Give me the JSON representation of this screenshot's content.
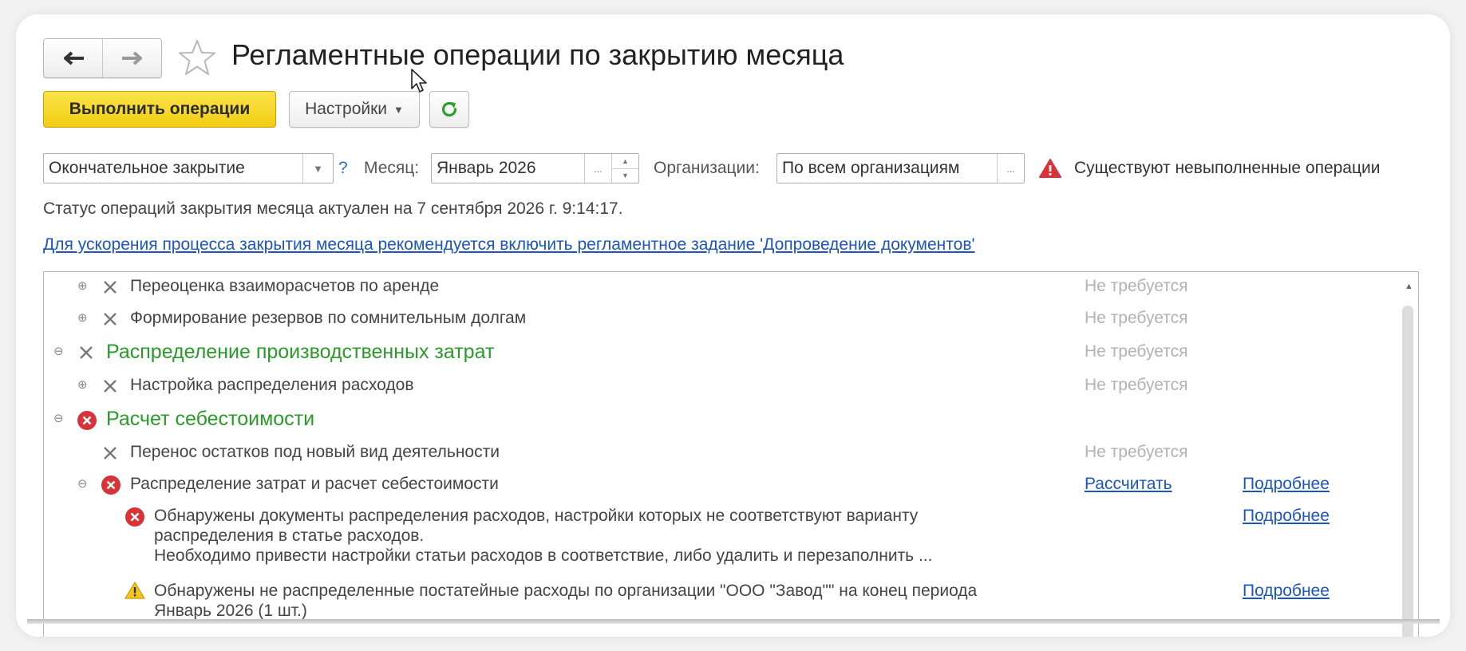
{
  "header": {
    "title": "Регламентные операции по закрытию месяца"
  },
  "toolbar": {
    "run_label": "Выполнить операции",
    "settings_label": "Настройки"
  },
  "filters": {
    "mode_value": "Окончательное закрытие",
    "help_label": "?",
    "month_label": "Месяц:",
    "month_value": "Январь 2026",
    "org_label": "Организации:",
    "org_value": "По всем организациям",
    "select_dots": "...",
    "warning_text": "Существуют невыполненные операции"
  },
  "status": {
    "text": "Статус операций закрытия месяца актуален на 7 сентября 2026 г. 9:14:17.",
    "hint_link": "Для ускорения процесса закрытия месяца рекомендуется включить регламентное задание 'Допроведение документов'"
  },
  "operations": [
    {
      "label": "Переоценка взаиморасчетов по аренде",
      "status": "Не требуется"
    },
    {
      "label": "Формирование резервов по сомнительным долгам",
      "status": "Не требуется"
    },
    {
      "label": "Распределение производственных затрат",
      "status": "Не требуется"
    },
    {
      "label": "Настройка распределения расходов",
      "status": "Не требуется"
    },
    {
      "label": "Расчет себестоимости"
    },
    {
      "label": "Перенос остатков под новый вид деятельности",
      "status": "Не требуется"
    },
    {
      "label": "Распределение затрат и расчет себестоимости",
      "action": "Рассчитать",
      "details": "Подробнее"
    }
  ],
  "messages": [
    {
      "line1": "Обнаружены документы распределения расходов, настройки которых не соответствуют варианту",
      "line2": "распределения в статье расходов.",
      "line3": "Необходимо привести настройки статьи расходов в соответствие, либо удалить и перезаполнить ...",
      "details": "Подробнее"
    },
    {
      "line1": "Обнаружены не распределенные постатейные расходы по организации \"ООО \"Завод\"\" на конец периода",
      "line2": "Январь 2026 (1 шт.)",
      "details": "Подробнее"
    }
  ],
  "colors": {
    "accent_yellow": "#f5d21f",
    "group_green": "#2a9a2a",
    "error_red": "#d9333a",
    "warning_yellow": "#f3c623",
    "link_blue": "#1b55c4"
  }
}
